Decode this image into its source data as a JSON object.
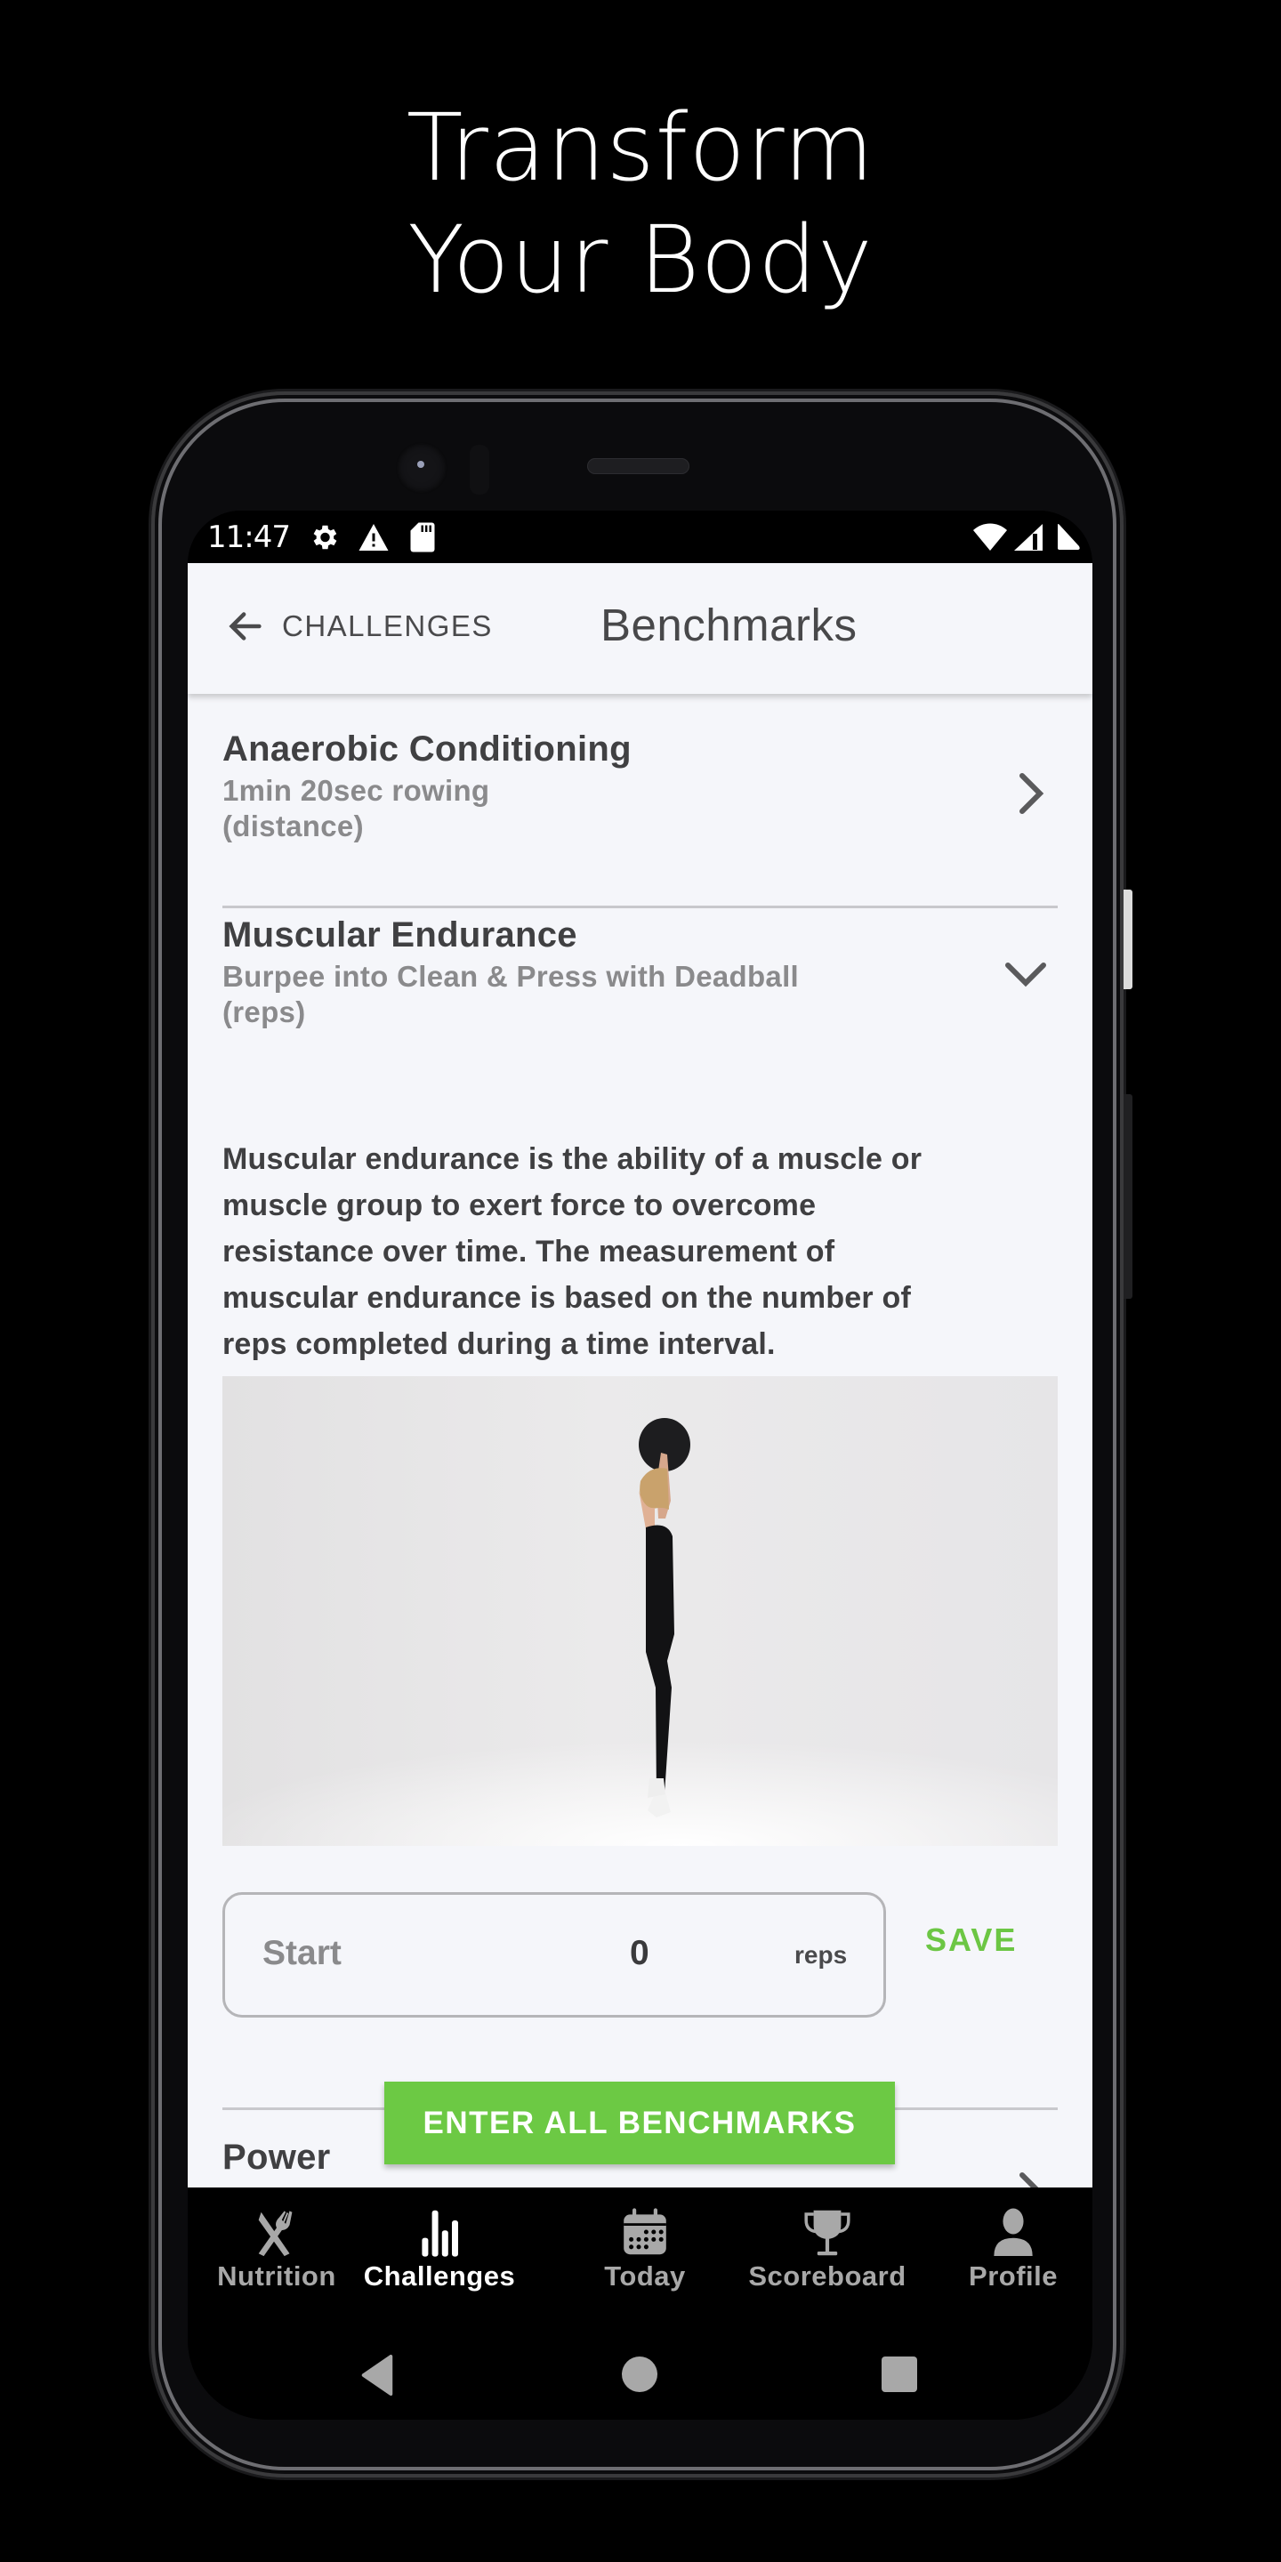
{
  "promo": {
    "line1": "Transform",
    "line2": "Your Body"
  },
  "status_bar": {
    "time": "11:47",
    "left_icons": [
      "settings-icon",
      "alert-icon",
      "sd-card-icon"
    ],
    "right_icons": [
      "wifi-icon",
      "signal-icon",
      "battery-icon"
    ]
  },
  "header": {
    "back_label": "CHALLENGES",
    "title": "Benchmarks"
  },
  "benchmarks": [
    {
      "title": "Anaerobic Conditioning",
      "subtitle_line1": "1min 20sec rowing",
      "subtitle_line2": "(distance)",
      "state": "collapsed"
    },
    {
      "title": "Muscular Endurance",
      "subtitle_line1": "Burpee into Clean & Press with Deadball",
      "subtitle_line2": "(reps)",
      "state": "expanded",
      "description": [
        "Muscular endurance is the ability of a muscle or",
        "muscle group to exert force to overcome",
        "resistance over time. The measurement of",
        "muscular endurance is based on the number of",
        "reps completed during a time interval."
      ],
      "image_alt": "Woman holding a medicine ball overhead",
      "input": {
        "label": "Start",
        "value": "0",
        "unit": "reps"
      },
      "save_label": "SAVE"
    },
    {
      "title": "Power",
      "state": "collapsed"
    }
  ],
  "cta_label": "ENTER ALL BENCHMARKS",
  "colors": {
    "accent": "#6cc944",
    "background": "#f5f6fa",
    "text": "#404042"
  },
  "tabs": [
    {
      "label": "Nutrition",
      "icon": "utensils-icon",
      "active": false
    },
    {
      "label": "Challenges",
      "icon": "bar-chart-icon",
      "active": true
    },
    {
      "label": "Today",
      "icon": "calendar-icon",
      "active": false
    },
    {
      "label": "Scoreboard",
      "icon": "trophy-icon",
      "active": false
    },
    {
      "label": "Profile",
      "icon": "user-icon",
      "active": false
    }
  ]
}
